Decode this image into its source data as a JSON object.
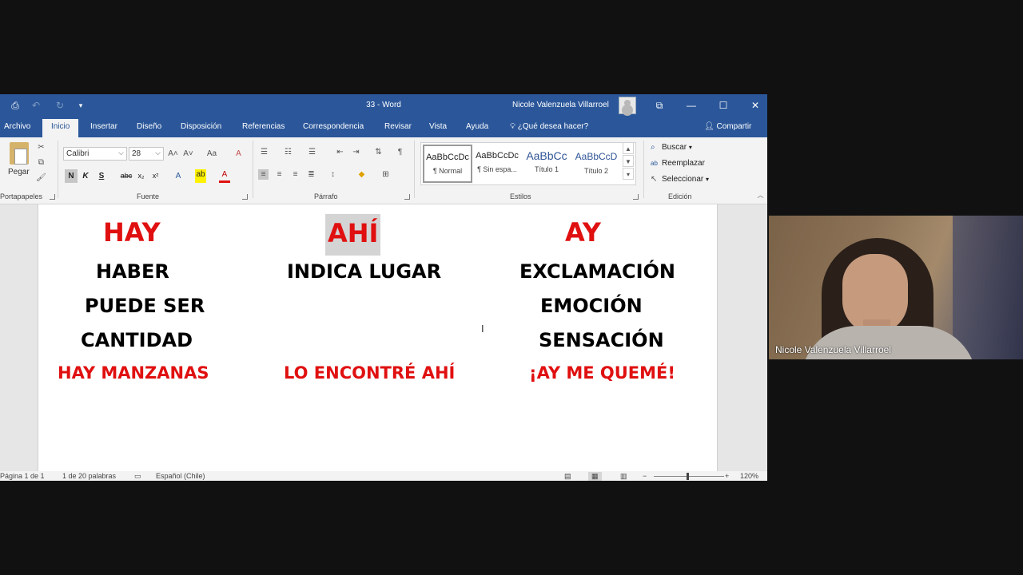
{
  "word": {
    "title": "33  -  Word",
    "user_name": "Nicole Valenzuela Villarroel",
    "tabs": [
      "Archivo",
      "Inicio",
      "Insertar",
      "Diseño",
      "Disposición",
      "Referencias",
      "Correspondencia",
      "Revisar",
      "Vista",
      "Ayuda"
    ],
    "active_tab": "Inicio",
    "tell_me": "¿Qué desea hacer?",
    "share": "Compartir",
    "ribbon": {
      "clipboard": {
        "paste_label": "Pegar",
        "group_label": "Portapapeles"
      },
      "font": {
        "font_name": "Calibri",
        "font_size": "28",
        "case_label": "Aa",
        "group_label": "Fuente",
        "bold": "N",
        "italic": "K",
        "underline": "S",
        "strike": "abc",
        "subscript": "x₂",
        "superscript": "x²"
      },
      "paragraph": {
        "group_label": "Párrafo"
      },
      "styles": {
        "group_label": "Estilos",
        "items": [
          {
            "sample": "AaBbCcDc",
            "name": "¶ Normal"
          },
          {
            "sample": "AaBbCcDc",
            "name": "¶ Sin espa..."
          },
          {
            "sample": "AaBbCc",
            "name": "Título 1"
          },
          {
            "sample": "AaBbCcD",
            "name": "Título 2"
          }
        ]
      },
      "editing": {
        "group_label": "Edición",
        "find": "Buscar",
        "replace": "Reemplazar",
        "select": "Seleccionar"
      }
    },
    "document": {
      "columns": [
        {
          "heading": "HAY",
          "lines": [
            "HABER",
            "PUEDE SER",
            "CANTIDAD"
          ],
          "example": "HAY MANZANAS"
        },
        {
          "heading": "AHÍ",
          "lines": [
            "INDICA LUGAR"
          ],
          "example": "LO ENCONTRÉ AHÍ"
        },
        {
          "heading": "AY",
          "lines": [
            "EXCLAMACIÓN",
            "EMOCIÓN",
            "SENSACIÓN"
          ],
          "example": "¡AY ME QUEMÉ!"
        }
      ]
    },
    "status": {
      "page": "Página 1 de 1",
      "words": "1 de 20 palabras",
      "language": "Español (Chile)",
      "zoom": "120%"
    },
    "colors": {
      "titlebar": "#2b579a",
      "highlight_red": "#e01010"
    }
  },
  "webcam": {
    "participant_name": "Nicole Valenzuela Villarroel"
  }
}
